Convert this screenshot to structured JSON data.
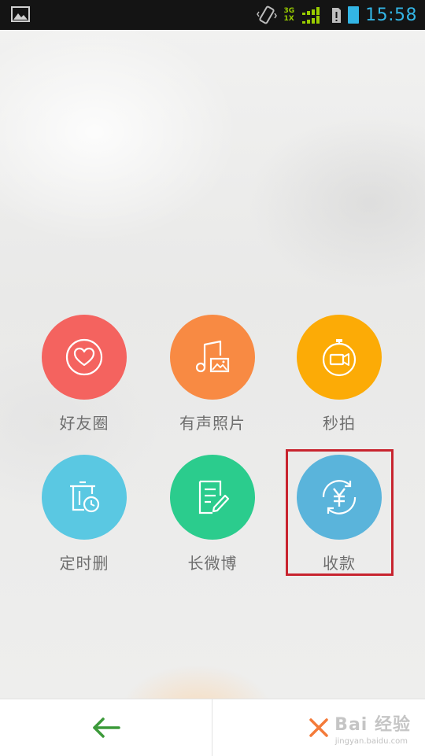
{
  "status_bar": {
    "net_top": "3G",
    "net_bottom": "1X",
    "time": "15:58"
  },
  "menu": {
    "items": [
      {
        "label": "好友圈",
        "color": "#f4635f",
        "icon": "heart-icon"
      },
      {
        "label": "有声照片",
        "color": "#f88a43",
        "icon": "music-photo-icon"
      },
      {
        "label": "秒拍",
        "color": "#fcab06",
        "icon": "video-timer-icon"
      },
      {
        "label": "定时删",
        "color": "#5ac8e2",
        "icon": "timed-delete-icon"
      },
      {
        "label": "长微博",
        "color": "#2bcc8d",
        "icon": "long-post-icon"
      },
      {
        "label": "收款",
        "color": "#5ab4db",
        "icon": "yuan-exchange-icon"
      }
    ]
  },
  "bottom_bar": {
    "back_icon": "arrow-left-icon",
    "close_icon": "close-x-icon",
    "watermark": "Bai 经验",
    "watermark_url": "jingyan.baidu.com"
  }
}
